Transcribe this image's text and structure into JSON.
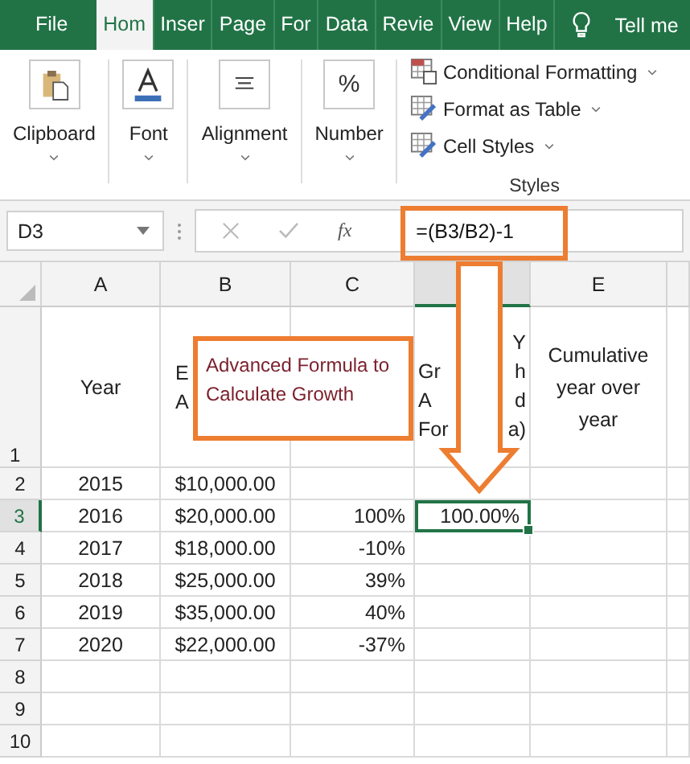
{
  "tabs": [
    {
      "label": "File",
      "selected": false
    },
    {
      "label": "Hom",
      "selected": true
    },
    {
      "label": "Inser",
      "selected": false
    },
    {
      "label": "Page",
      "selected": false
    },
    {
      "label": "For",
      "selected": false
    },
    {
      "label": "Data",
      "selected": false
    },
    {
      "label": "Revie",
      "selected": false
    },
    {
      "label": "View",
      "selected": false
    },
    {
      "label": "Help",
      "selected": false
    }
  ],
  "tell_me": "Tell me",
  "ribbon_groups": [
    {
      "kind": "clipboard",
      "label": "Clipboard"
    },
    {
      "kind": "font",
      "label": "Font"
    },
    {
      "kind": "alignment",
      "label": "Alignment"
    },
    {
      "kind": "number",
      "label": "Number",
      "icon_text": "%"
    }
  ],
  "styles": {
    "items": [
      {
        "kind": "conditional",
        "label": "Conditional Formatting"
      },
      {
        "kind": "table",
        "label": "Format as Table"
      },
      {
        "kind": "cellstyles",
        "label": "Cell Styles"
      }
    ],
    "label": "Styles"
  },
  "formula_bar": {
    "name_box": "D3",
    "fx": "fx",
    "formula": "=(B3/B2)-1"
  },
  "columns": [
    {
      "label": "A",
      "selected": false
    },
    {
      "label": "B",
      "selected": false
    },
    {
      "label": "C",
      "selected": false
    },
    {
      "selected": true
    },
    {
      "label": "E",
      "selected": false
    }
  ],
  "header_row": {
    "num": "1",
    "year": "Year",
    "col_b_fragments": [
      "E",
      "A"
    ],
    "col_d_fragments": [
      {
        "right": "Y"
      },
      {
        "left": "Gr",
        "right": "h"
      },
      {
        "left": "A",
        "right": "d"
      },
      {
        "left": "For",
        "right": "a)"
      }
    ],
    "col_e": "Cumulative year over year"
  },
  "rows": [
    {
      "num": "2",
      "selected": false,
      "year": "2015",
      "amount": "$10,000.00"
    },
    {
      "num": "3",
      "selected": true,
      "year": "2016",
      "amount": "$20,000.00",
      "growth": "100%",
      "formula_result": "100.00%"
    },
    {
      "num": "4",
      "selected": false,
      "year": "2017",
      "amount": "$18,000.00",
      "growth": "-10%"
    },
    {
      "num": "5",
      "selected": false,
      "year": "2018",
      "amount": "$25,000.00",
      "growth": "39%"
    },
    {
      "num": "6",
      "selected": false,
      "year": "2019",
      "amount": "$35,000.00",
      "growth": "40%"
    },
    {
      "num": "7",
      "selected": false,
      "year": "2020",
      "amount": "$22,000.00",
      "growth": "-37%"
    },
    {
      "num": "8",
      "selected": false
    },
    {
      "num": "9",
      "selected": false
    },
    {
      "num": "10",
      "selected": false
    }
  ],
  "callout": "Advanced Formula to Calculate Growth"
}
